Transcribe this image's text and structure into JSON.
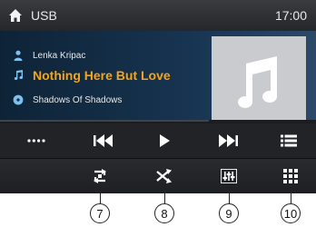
{
  "header": {
    "title": "USB",
    "clock": "17:00"
  },
  "track": {
    "artist": "Lenka Kripac",
    "song": "Nothing Here But Love",
    "album": "Shadows Of Shadows"
  },
  "icons": {
    "home": "home-icon",
    "artist": "person-icon",
    "song": "music-note-icon",
    "album": "disc-icon",
    "album_art": "music-note-icon",
    "more": "more-dots-icon",
    "prev": "previous-track-icon",
    "play": "play-icon",
    "next": "next-track-icon",
    "list": "playlist-icon",
    "repeat": "repeat-icon",
    "shuffle": "shuffle-icon",
    "eq": "equalizer-icon",
    "menu": "grid-menu-icon"
  },
  "colors": {
    "song_title": "#f6a51a",
    "accent_icon": "#7ec0ee",
    "screen_bg": "#1c1d20"
  },
  "callouts": [
    "7",
    "8",
    "9",
    "10"
  ]
}
